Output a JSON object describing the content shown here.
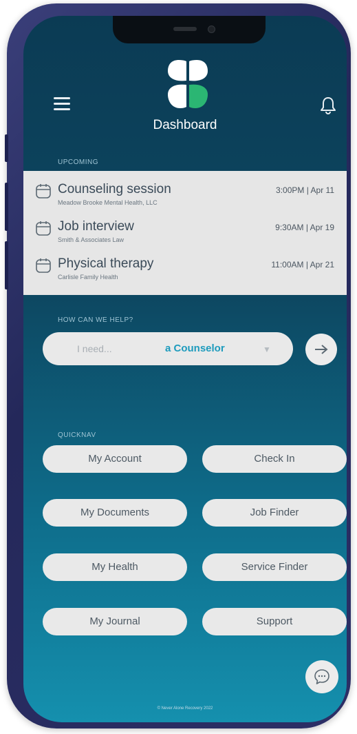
{
  "header": {
    "title": "Dashboard",
    "menu_icon": "hamburger-menu-icon",
    "notification_icon": "bell-icon"
  },
  "upcoming": {
    "label": "UPCOMING",
    "items": [
      {
        "title": "Counseling session",
        "subtitle": "Meadow Brooke Mental Health, LLC",
        "when": "3:00PM | Apr 11"
      },
      {
        "title": "Job interview",
        "subtitle": "Smith & Associates Law",
        "when": "9:30AM | Apr 19"
      },
      {
        "title": "Physical therapy",
        "subtitle": "Carlisle Family Health",
        "when": "11:00AM | Apr 21"
      }
    ]
  },
  "help": {
    "label": "HOW CAN WE HELP?",
    "placeholder": "I need...",
    "selected": "a Counselor",
    "caret": "▼"
  },
  "quicknav": {
    "label": "QUICKNAV",
    "items": [
      "My Account",
      "Check In",
      "My Documents",
      "Job Finder",
      "My Health",
      "Service Finder",
      "My Journal",
      "Support"
    ]
  },
  "footer": {
    "text": "© Never Alone Recovery 2022"
  },
  "colors": {
    "accent": "#1d9bbd",
    "logo_green": "#2bb673",
    "background_top": "#0b3b54",
    "background_bottom": "#1590ae"
  }
}
